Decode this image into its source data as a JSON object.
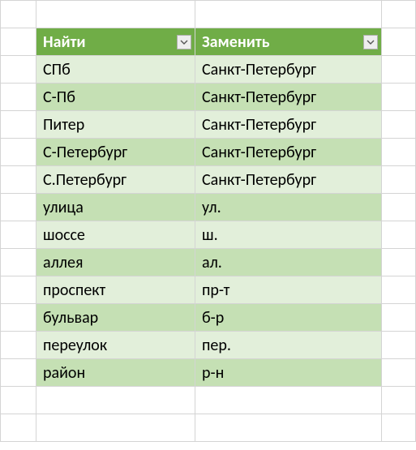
{
  "table": {
    "headers": {
      "find": "Найти",
      "replace": "Заменить"
    },
    "rows": [
      {
        "find": "СПб",
        "replace": "Санкт-Петербург"
      },
      {
        "find": "С-Пб",
        "replace": "Санкт-Петербург"
      },
      {
        "find": "Питер",
        "replace": "Санкт-Петербург"
      },
      {
        "find": "С-Петербург",
        "replace": "Санкт-Петербург"
      },
      {
        "find": "С.Петербург",
        "replace": "Санкт-Петербург"
      },
      {
        "find": "улица",
        "replace": "ул."
      },
      {
        "find": "шоссе",
        "replace": "ш."
      },
      {
        "find": "аллея",
        "replace": "ал."
      },
      {
        "find": "проспект",
        "replace": "пр-т"
      },
      {
        "find": "бульвар",
        "replace": "б-р"
      },
      {
        "find": "переулок",
        "replace": "пер."
      },
      {
        "find": "район",
        "replace": "р-н"
      }
    ]
  }
}
